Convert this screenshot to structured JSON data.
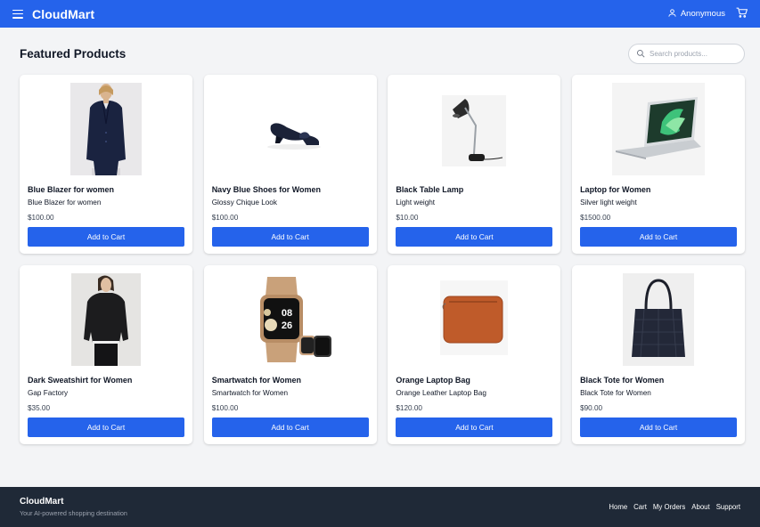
{
  "navbar": {
    "brand": "CloudMart",
    "user_label": "Anonymous",
    "menu_icon": "hamburger-menu-icon",
    "user_icon": "user-icon",
    "cart_icon": "shopping-cart-icon"
  },
  "main": {
    "heading": "Featured Products",
    "search": {
      "placeholder": "Search products...",
      "value": ""
    }
  },
  "products": [
    {
      "name": "Blue Blazer for women",
      "description": "Blue Blazer for women",
      "price": "$100.00",
      "button": "Add to Cart"
    },
    {
      "name": "Navy Blue Shoes for Women",
      "description": "Glossy Chique Look",
      "price": "$100.00",
      "button": "Add to Cart"
    },
    {
      "name": "Black Table Lamp",
      "description": "Light weight",
      "price": "$10.00",
      "button": "Add to Cart"
    },
    {
      "name": "Laptop for Women",
      "description": "Silver light weight",
      "price": "$1500.00",
      "button": "Add to Cart"
    },
    {
      "name": "Dark Sweatshirt for Women",
      "description": "Gap Factory",
      "price": "$35.00",
      "button": "Add to Cart"
    },
    {
      "name": "Smartwatch for Women",
      "description": "Smartwatch for Women",
      "price": "$100.00",
      "button": "Add to Cart"
    },
    {
      "name": "Orange Laptop Bag",
      "description": "Orange Leather Laptop Bag",
      "price": "$120.00",
      "button": "Add to Cart"
    },
    {
      "name": "Black Tote for Women",
      "description": "Black Tote for Women",
      "price": "$90.00",
      "button": "Add to Cart"
    }
  ],
  "smartwatch_screen": {
    "hour": "08",
    "minute": "26"
  },
  "footer": {
    "brand": "CloudMart",
    "tagline": "Your AI-powered shopping destination",
    "links": [
      "Home",
      "Cart",
      "My Orders",
      "About",
      "Support"
    ]
  },
  "colors": {
    "primary": "#2563eb",
    "footer_bg": "#1f2937",
    "page_bg": "#f3f4f6"
  }
}
